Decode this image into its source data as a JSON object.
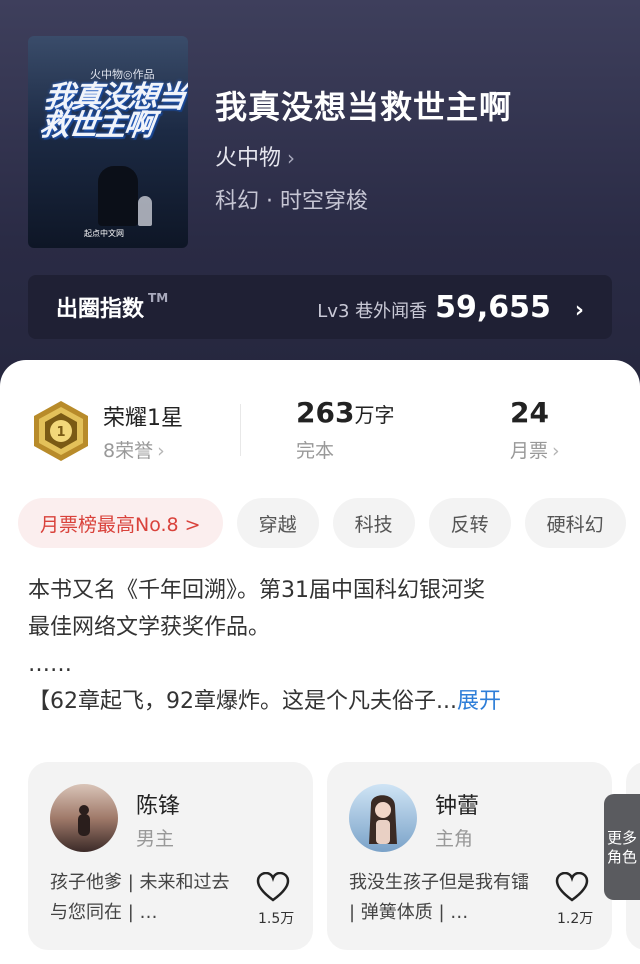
{
  "book": {
    "title": "我真没想当救世主啊",
    "author": "火中物",
    "genre": "科幻 · 时空穿梭",
    "cover": {
      "title_text": "我真没想当救世主啊",
      "author_text": "火中物◎作品",
      "publisher_text": "起点中文网"
    }
  },
  "index": {
    "label": "出圈指数",
    "tm": "TM",
    "level": "Lv3 巷外闻香",
    "score": "59,655"
  },
  "stats": {
    "honor_title": "荣耀1星",
    "honor_sub": "8荣誉",
    "words_value": "263",
    "words_unit": "万字",
    "status": "完本",
    "tickets_value": "24",
    "tickets_label": "月票"
  },
  "tags": [
    "月票榜最高No.8 >",
    "穿越",
    "科技",
    "反转",
    "硬科幻"
  ],
  "description": {
    "line1": "本书又名《千年回溯》。第31届中国科幻银河奖",
    "line2": "最佳网络文学获奖作品。",
    "line3": "……",
    "line4": "【62章起飞，92章爆炸。这是个凡夫俗子...",
    "expand": "展开"
  },
  "characters": [
    {
      "name": "陈锋",
      "role": "男主",
      "tagline": "孩子他爹 | 未来和过去与您同在 | …",
      "likes": "1.5万"
    },
    {
      "name": "钟蕾",
      "role": "主角",
      "tagline": "我没生孩子但是我有镭 | 弹簧体质 | …",
      "likes": "1.2万"
    }
  ],
  "more_roles": "更多角色",
  "colors": {
    "hero_bg": "#2f304b",
    "accent_red": "#d9423b",
    "link_blue": "#2e7ed8",
    "medal_gold": "#c9a13a"
  }
}
